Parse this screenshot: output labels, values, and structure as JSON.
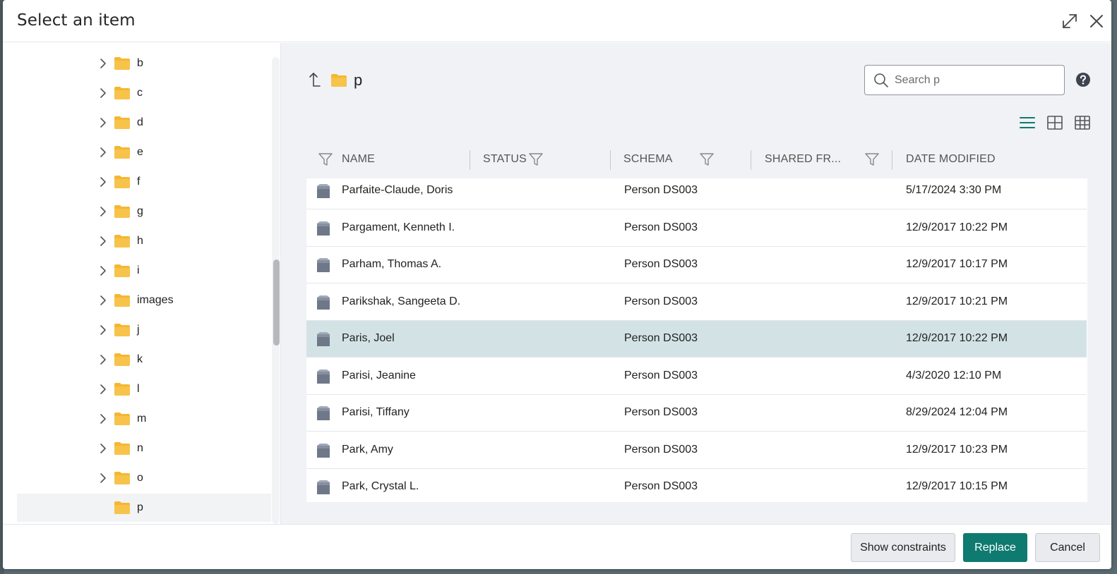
{
  "dialog": {
    "title": "Select an item",
    "expand_icon": "expand-diagonal-icon",
    "close_icon": "close-icon"
  },
  "tree": {
    "items": [
      {
        "label": "b",
        "expandable": true
      },
      {
        "label": "c",
        "expandable": true
      },
      {
        "label": "d",
        "expandable": true
      },
      {
        "label": "e",
        "expandable": true
      },
      {
        "label": "f",
        "expandable": true
      },
      {
        "label": "g",
        "expandable": true
      },
      {
        "label": "h",
        "expandable": true
      },
      {
        "label": "i",
        "expandable": true
      },
      {
        "label": "images",
        "expandable": true
      },
      {
        "label": "j",
        "expandable": true
      },
      {
        "label": "k",
        "expandable": true
      },
      {
        "label": "l",
        "expandable": true
      },
      {
        "label": "m",
        "expandable": true
      },
      {
        "label": "n",
        "expandable": true
      },
      {
        "label": "o",
        "expandable": true
      },
      {
        "label": "p",
        "expandable": false,
        "selected": true
      }
    ]
  },
  "browser": {
    "current_folder": "p",
    "search_placeholder": "Search p"
  },
  "table": {
    "columns": {
      "name": "NAME",
      "status": "STATUS",
      "schema": "SCHEMA",
      "shared_from": "SHARED FR...",
      "date_modified": "DATE MODIFIED"
    },
    "rows": [
      {
        "name": "Parfaite-Claude, Doris",
        "status": "",
        "schema": "Person DS003",
        "shared_from": "",
        "date": "5/17/2024 3:30 PM"
      },
      {
        "name": "Pargament, Kenneth I.",
        "status": "",
        "schema": "Person DS003",
        "shared_from": "",
        "date": "12/9/2017 10:22 PM"
      },
      {
        "name": "Parham, Thomas A.",
        "status": "",
        "schema": "Person DS003",
        "shared_from": "",
        "date": "12/9/2017 10:17 PM"
      },
      {
        "name": "Parikshak, Sangeeta D.",
        "status": "",
        "schema": "Person DS003",
        "shared_from": "",
        "date": "12/9/2017 10:21 PM"
      },
      {
        "name": "Paris, Joel",
        "status": "",
        "schema": "Person DS003",
        "shared_from": "",
        "date": "12/9/2017 10:22 PM",
        "selected": true
      },
      {
        "name": "Parisi, Jeanine",
        "status": "",
        "schema": "Person DS003",
        "shared_from": "",
        "date": "4/3/2020 12:10 PM"
      },
      {
        "name": "Parisi, Tiffany",
        "status": "",
        "schema": "Person DS003",
        "shared_from": "",
        "date": "8/29/2024 12:04 PM"
      },
      {
        "name": "Park, Amy",
        "status": "",
        "schema": "Person DS003",
        "shared_from": "",
        "date": "12/9/2017 10:23 PM"
      },
      {
        "name": "Park, Crystal L.",
        "status": "",
        "schema": "Person DS003",
        "shared_from": "",
        "date": "12/9/2017 10:15 PM"
      }
    ]
  },
  "footer": {
    "show_constraints": "Show constraints",
    "replace": "Replace",
    "cancel": "Cancel"
  },
  "colors": {
    "accent": "#0f7a70",
    "folder": "#f5b731",
    "selected_row": "#d3e3e5",
    "item_icon": "#6f7889"
  }
}
